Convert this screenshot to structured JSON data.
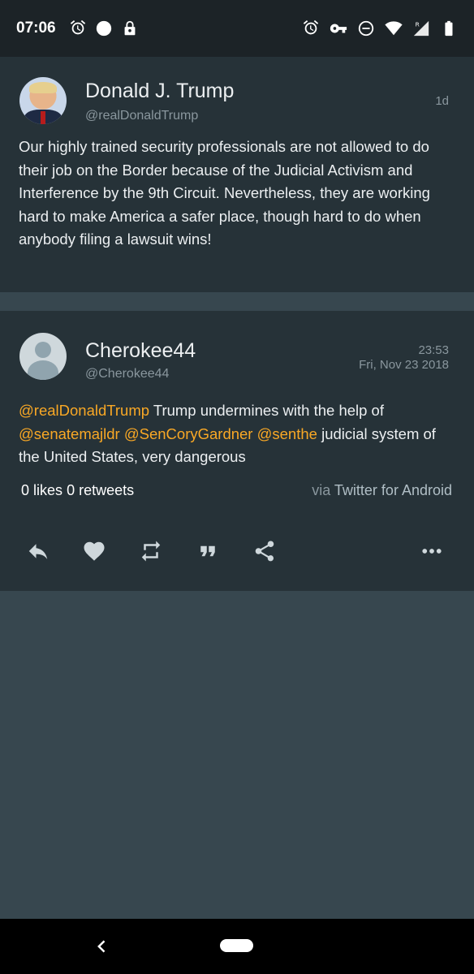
{
  "status_bar": {
    "time": "07:06",
    "left_icons": [
      "alarm-icon",
      "circle-icon",
      "lock-icon"
    ],
    "right_icons": [
      "alarm-icon",
      "vpn-key-icon",
      "do-not-disturb-icon",
      "wifi-icon",
      "signal-icon",
      "battery-icon"
    ],
    "signal_badge": "R"
  },
  "parent_tweet": {
    "name": "Donald J. Trump",
    "handle": "@realDonaldTrump",
    "age": "1d",
    "text": "Our highly trained security professionals are not allowed to do their job on the Border because of the Judicial Activism and Interference by the 9th Circuit. Nevertheless, they are working hard to make America a safer place, though hard to do when anybody filing a lawsuit wins!"
  },
  "reply_tweet": {
    "name": "Cherokee44",
    "handle": "@Cherokee44",
    "time": "23:53",
    "date": "Fri, Nov 23 2018",
    "text_parts": {
      "m1": "@realDonaldTrump",
      "t1": " Trump undermines with the help of ",
      "m2": "@senatemajldr",
      "t2": " ",
      "m3": "@SenCoryGardner",
      "t3": " ",
      "m4": "@senthe",
      "t4": " judicial system of the United States, very dangerous"
    },
    "likes_count": "0",
    "likes_label": "likes",
    "retweets_count": "0",
    "retweets_label": "retweets",
    "via_prefix": "via",
    "client": "Twitter for Android"
  },
  "actions": [
    "reply-icon",
    "like-icon",
    "retweet-icon",
    "quote-icon",
    "share-icon",
    "more-icon"
  ],
  "colors": {
    "background": "#37474f",
    "card": "#263238",
    "mention": "#f9a825",
    "statusbar": "#1c2327"
  }
}
